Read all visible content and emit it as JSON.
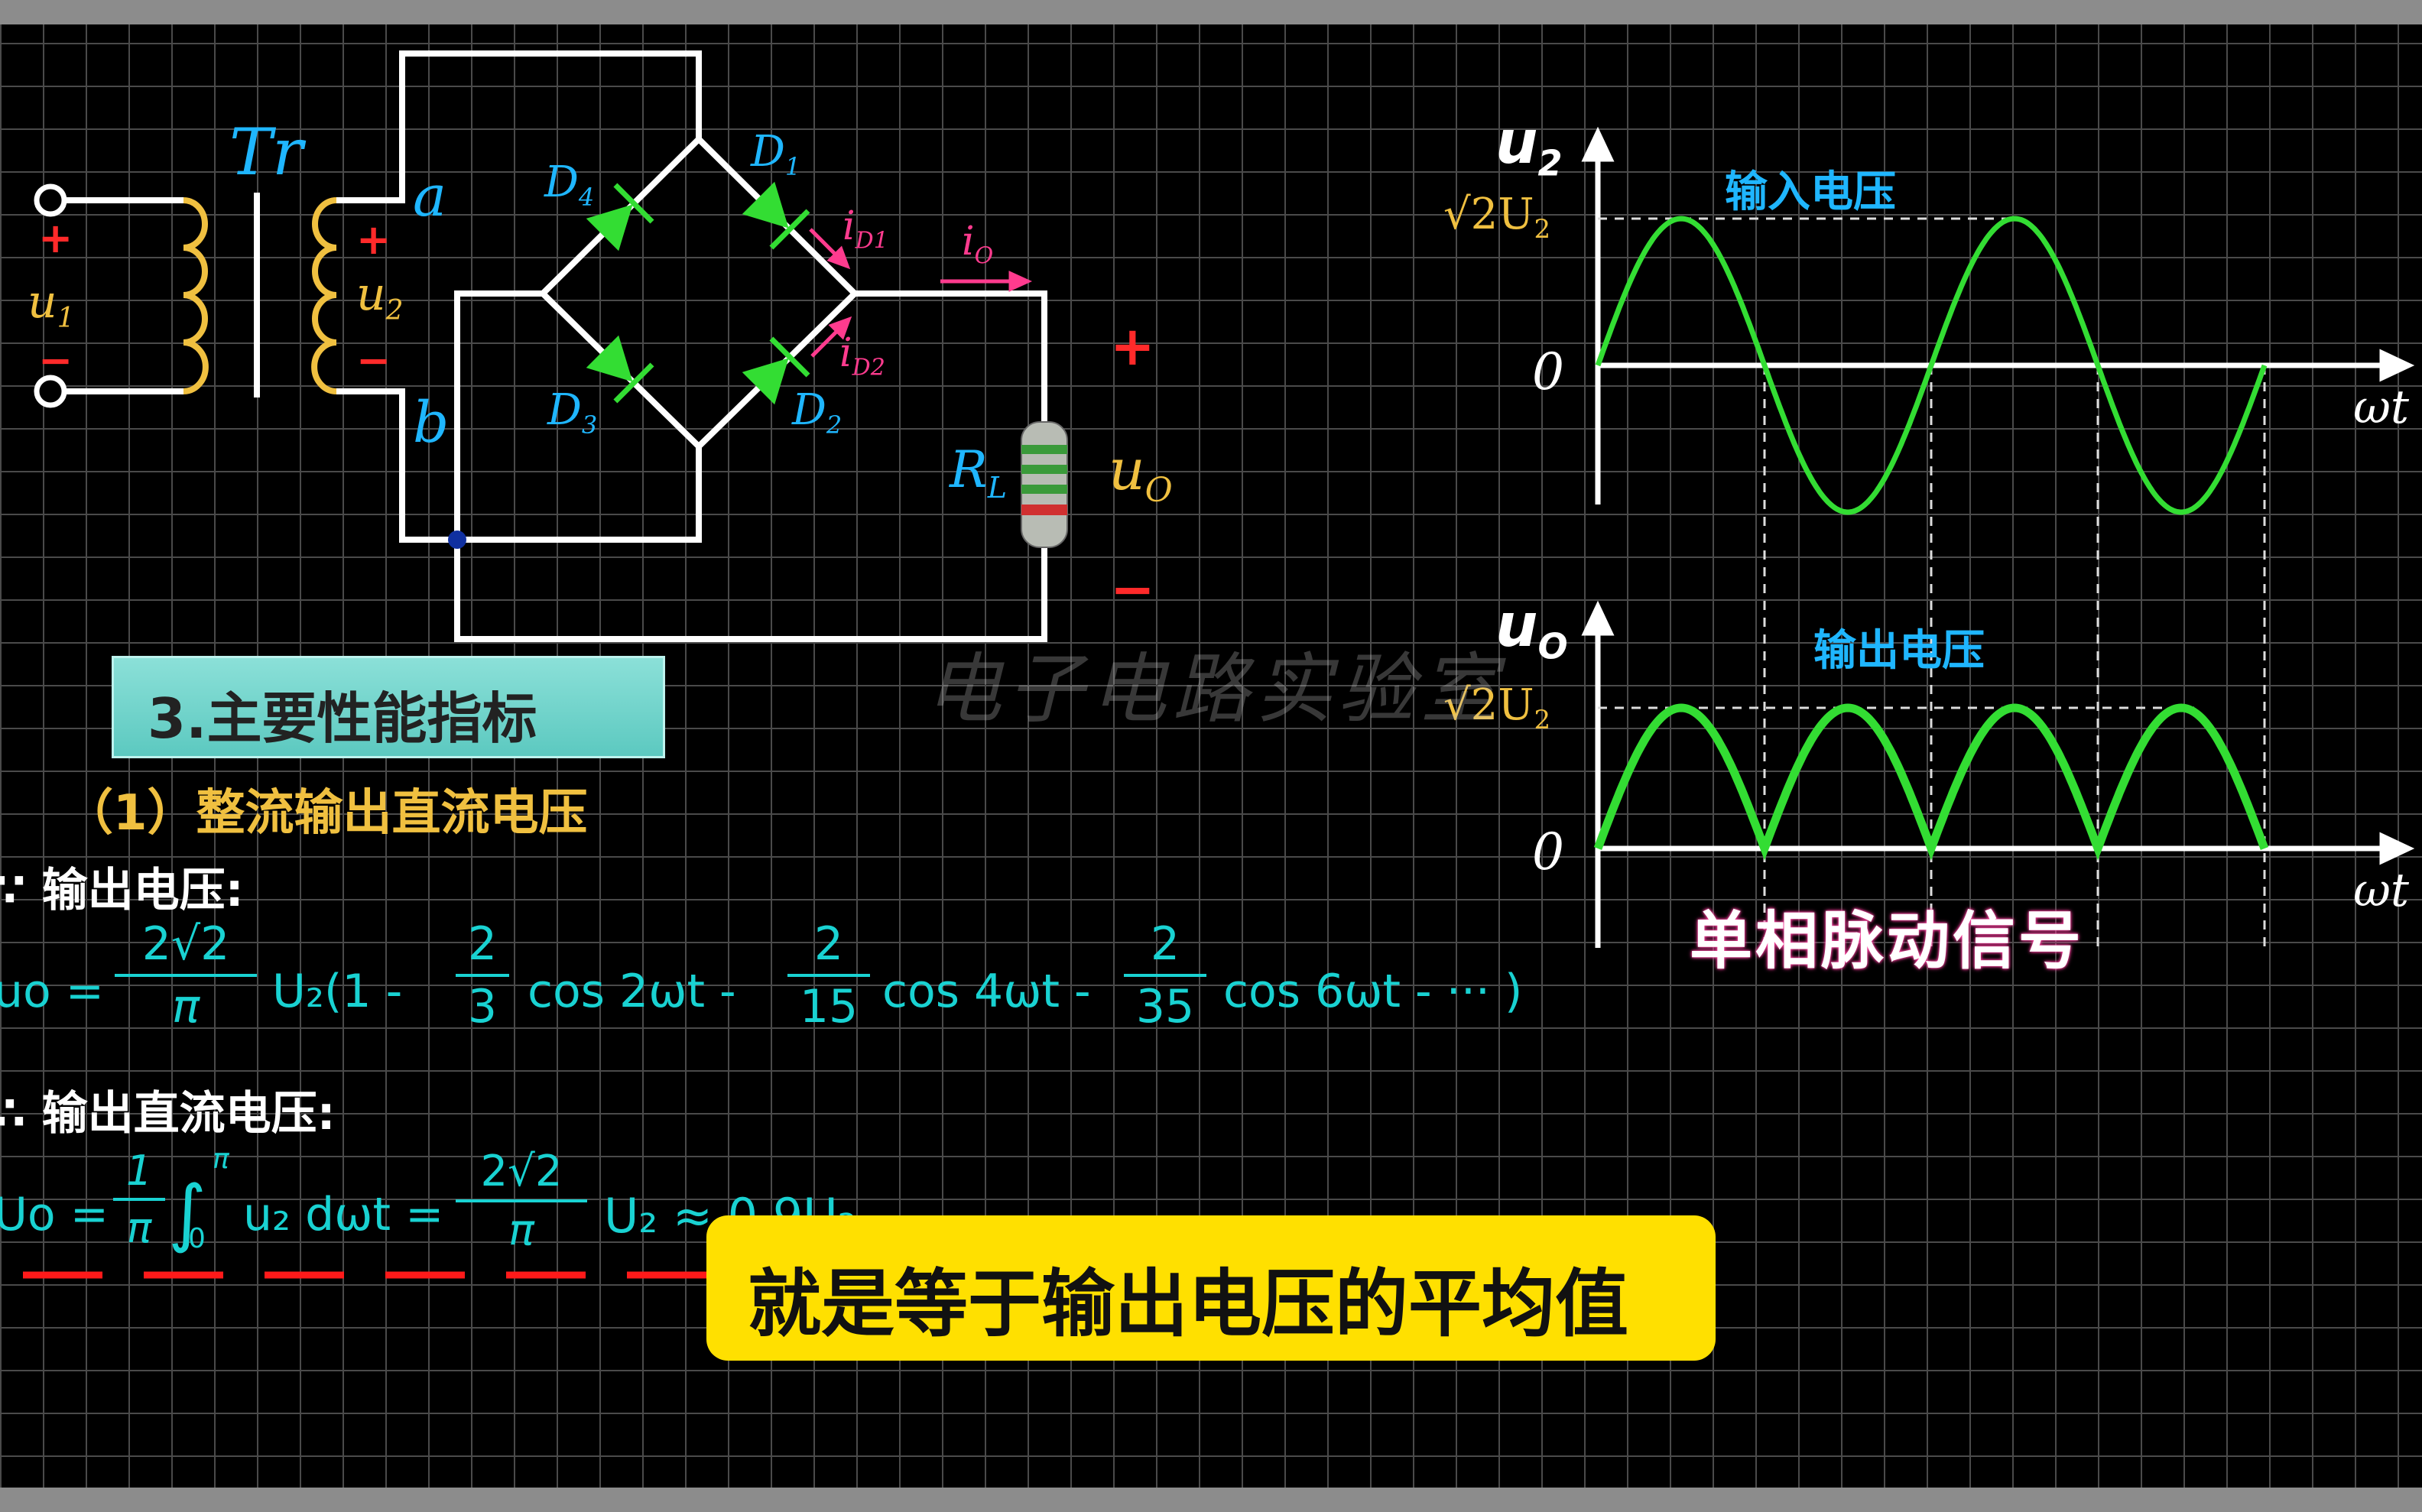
{
  "circuit": {
    "transformer": "Tr",
    "input_voltage": "u",
    "input_sub": "1",
    "secondary_voltage": "u",
    "secondary_sub": "2",
    "plus": "+",
    "minus": "−",
    "node_a": "a",
    "node_b": "b",
    "d1": "D",
    "d1_sub": "1",
    "d2": "D",
    "d2_sub": "2",
    "d3": "D",
    "d3_sub": "3",
    "d4": "D",
    "d4_sub": "4",
    "id1": "i",
    "id1_sub": "D1",
    "id2": "i",
    "id2_sub": "D2",
    "io": "i",
    "io_sub": "O",
    "rl": "R",
    "rl_sub": "L",
    "uo": "u",
    "uo_sub": "O"
  },
  "graphs": {
    "top_y": "u",
    "top_y_sub": "2",
    "top_title": "输入电压",
    "amp_label": "√2U",
    "amp_sub": "2",
    "zero": "0",
    "x_label": "ωt",
    "bottom_y": "u",
    "bottom_y_sub": "O",
    "bottom_title": "输出电压",
    "bottom_caption": "单相脉动信号"
  },
  "section": {
    "heading": "3.主要性能指标",
    "item1": "（1）整流输出直流电压",
    "since_line": "∵ 输出电压:",
    "therefore_line": "∴ 输出直流电压:"
  },
  "formula1": {
    "lhs": "uo =",
    "coef_num": "2√2",
    "coef_den": "π",
    "u2": "U₂",
    "open": "(1 -",
    "f1_num": "2",
    "f1_den": "3",
    "f1_term": "cos 2ωt -",
    "f2_num": "2",
    "f2_den": "15",
    "f2_term": "cos 4ωt -",
    "f3_num": "2",
    "f3_den": "35",
    "f3_term": "cos 6ωt - ··· )"
  },
  "formula2": {
    "lhs": "Uo =",
    "int_num": "1",
    "int_den": "π",
    "int_upper": "π",
    "int_lower": "0",
    "integrand": "u₂ dωt =",
    "coef_num": "2√2",
    "coef_den": "π",
    "rhs": "U₂ ≈ 0.9U₂"
  },
  "watermark": "电子电路实验室",
  "subtitle": "就是等于输出电压的平均值",
  "chart_data": [
    {
      "type": "line",
      "title": "输入电压",
      "xlabel": "ωt",
      "ylabel": "u2",
      "series": [
        {
          "values_description": "",
          "x": [
            0,
            0.5,
            1,
            1.5,
            2,
            2.5,
            3,
            3.5,
            4
          ],
          "values": [
            0,
            1,
            0,
            -1,
            0,
            1,
            0,
            -1,
            0
          ]
        }
      ],
      "x_unit": "π",
      "y_ticks": [
        "0",
        "√2U2"
      ],
      "ylim": [
        -1,
        1
      ]
    },
    {
      "type": "line",
      "title": "输出电压",
      "xlabel": "ωt",
      "ylabel": "uO",
      "series": [
        {
          "x": [
            0,
            0.5,
            1,
            1.5,
            2,
            2.5,
            3,
            3.5,
            4
          ],
          "values": [
            0,
            1,
            0,
            1,
            0,
            1,
            0,
            1,
            0
          ]
        }
      ],
      "x_unit": "π",
      "y_ticks": [
        "0",
        "√2U2"
      ],
      "ylim": [
        0,
        1
      ]
    }
  ],
  "colors": {
    "wire": "#ffffff",
    "diode": "#33dd33",
    "waveform": "#33dd33",
    "coil": "#f0c040",
    "label_blue": "#1fb6ff",
    "formula": "#19d2d2",
    "dash": "#ff1a1a",
    "subtitle_bg": "#ffe000"
  }
}
